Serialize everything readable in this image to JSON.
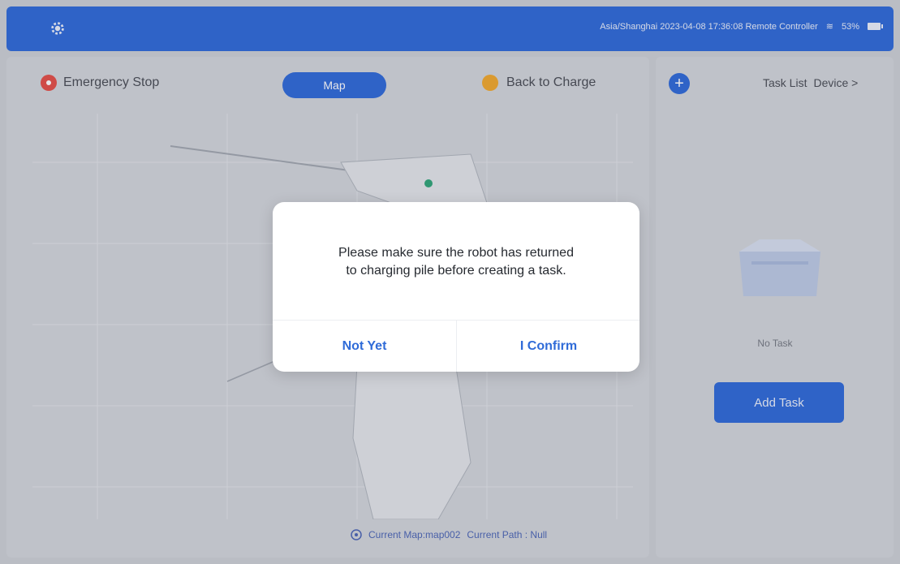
{
  "topbar": {
    "status_text": "Asia/Shanghai 2023-04-08 17:36:08  Remote Controller",
    "signal_glyph": "≋",
    "battery": "53%"
  },
  "controls": {
    "emergency_stop": "Emergency Stop",
    "map_button": "Map",
    "back_to_charge": "Back to Charge",
    "add_symbol": "+"
  },
  "right_panel": {
    "task_list": "Task List",
    "device": "Device",
    "chevron": ">",
    "no_task": "No Task",
    "add_task": "Add Task"
  },
  "footer": {
    "current_map": "Current Map:map002",
    "current_path": "Current Path : Null"
  },
  "modal": {
    "message_line1": "Please make sure the robot has returned",
    "message_line2": "to charging pile before creating a task.",
    "not_yet": "Not Yet",
    "confirm": "I Confirm"
  },
  "colors": {
    "primary": "#1f5fd6",
    "emergency": "#e2413a",
    "charge": "#f0a21e",
    "button_text": "#2f6bd8"
  }
}
